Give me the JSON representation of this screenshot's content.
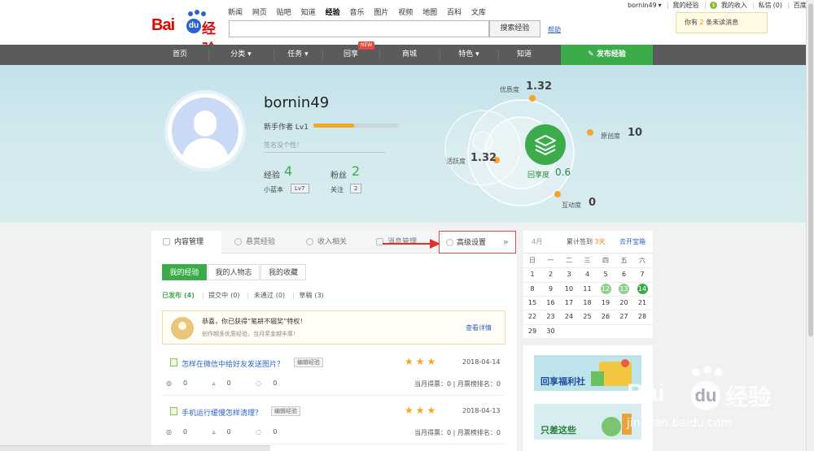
{
  "logo": {
    "bai": "Bai",
    "du": "du",
    "jingyan": "经验"
  },
  "top_nav": [
    "新闻",
    "网页",
    "贴吧",
    "知道",
    "经验",
    "音乐",
    "图片",
    "视频",
    "地图",
    "百科",
    "文库"
  ],
  "search": {
    "button": "搜索经验",
    "help": "帮助"
  },
  "user_bar": {
    "name": "bornin49",
    "my_exp": "我的经验",
    "coin": "$",
    "my_income": "我的收入",
    "messages": "私信",
    "count": "(0)",
    "home": "百度首页"
  },
  "msg_popup": {
    "pre": "你有 ",
    "count": "2",
    "post": " 条未读消息"
  },
  "nav": {
    "items": [
      "首页",
      "分类",
      "任务",
      "回享",
      "商城",
      "特色",
      "知道"
    ],
    "new_badge": "NEW",
    "publish": "发布经验"
  },
  "profile": {
    "username": "bornin49",
    "level": "新手作者 Lv1",
    "level_progress": 0.48,
    "sign_placeholder": "签名没个性！",
    "exp_label": "经验",
    "exp_value": "4",
    "fans_label": "粉丝",
    "fans_value": "2",
    "blue_label": "小蓝本",
    "blue_value": "Lv7",
    "follow_label": "关注",
    "follow_value": "2"
  },
  "radar": {
    "quality_label": "优质度",
    "quality": "1.32",
    "original_label": "原创度",
    "original": "10",
    "active_label": "活跃度",
    "active": "1.32",
    "interact_label": "互动度",
    "interact": "0",
    "share_label": "回享度",
    "share": "0.6"
  },
  "tabs": {
    "content": "内容管理",
    "reward": "悬赏经验",
    "income": "收入相关",
    "message": "消息管理",
    "advanced": "高级设置",
    "more": "»"
  },
  "subtabs": [
    "我的经验",
    "我的人物志",
    "我的收藏"
  ],
  "filters": {
    "published": "已发布",
    "published_count": "(4)",
    "submitting": "提交中",
    "submitting_count": "(0)",
    "rejected": "未通过",
    "rejected_count": "(0)",
    "draft": "草稿",
    "draft_count": "(3)"
  },
  "notice": {
    "title": "恭喜，你已获得“笔耕不辍奖”特权！",
    "sub": "创作越多优质经验，当月奖金越丰厚！",
    "link": "查看详情"
  },
  "experiences": [
    {
      "title": "怎样在微信中给好友发送图片？",
      "edit": "编辑经验",
      "date": "2018-04-14",
      "views": "0",
      "votes": "0",
      "comments": "0",
      "rank": "当月得票：0 | 月票榜排名：0"
    },
    {
      "title": "手机运行缓慢怎样清理？",
      "edit": "编辑经验",
      "date": "2018-04-13",
      "views": "0",
      "votes": "0",
      "comments": "0",
      "rank": "当月得票：0 | 月票榜排名：0"
    }
  ],
  "calendar": {
    "month": "4月",
    "checkin_pre": "累计签到 ",
    "checkin_days": "3天",
    "open_box": "去开宝箱",
    "weekdays": [
      "日",
      "一",
      "二",
      "三",
      "四",
      "五",
      "六"
    ],
    "weeks": [
      [
        "1",
        "2",
        "3",
        "4",
        "5",
        "6",
        "7"
      ],
      [
        "8",
        "9",
        "10",
        "11",
        "12",
        "13",
        "14"
      ],
      [
        "15",
        "16",
        "17",
        "18",
        "19",
        "20",
        "21"
      ],
      [
        "22",
        "23",
        "24",
        "25",
        "26",
        "27",
        "28"
      ],
      [
        "29",
        "30",
        "",
        "",
        "",
        "",
        ""
      ]
    ],
    "signed": [
      "12",
      "13",
      "14"
    ],
    "today": "14"
  },
  "ads": [
    {
      "title": "回享福利社"
    },
    {
      "title": "只差这些"
    }
  ],
  "watermark": {
    "url": "jingyan.baidu.com"
  },
  "colors": {
    "green": "#3cab4b",
    "nav_bg": "#5a5b5d",
    "link": "#2b64c4",
    "orange": "#f5a623",
    "red": "#e10601"
  }
}
